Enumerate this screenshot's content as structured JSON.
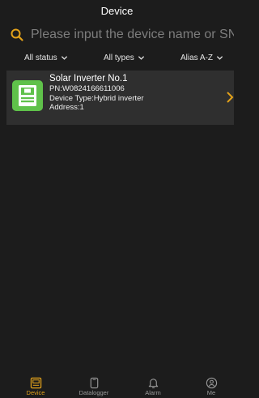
{
  "header": {
    "title": "Device"
  },
  "search": {
    "placeholder": "Please input the device name or SN"
  },
  "filters": [
    {
      "label": "All status"
    },
    {
      "label": "All types"
    },
    {
      "label": "Alias A-Z"
    }
  ],
  "devices": [
    {
      "name": "Solar Inverter No.1",
      "pn": "PN:W0824166611006",
      "type": "Device Type:Hybrid inverter",
      "address": "Address:1",
      "icon": "inverter-icon",
      "icon_color": "#5fc14a"
    }
  ],
  "tabs": [
    {
      "label": "Device",
      "icon": "device-icon",
      "active": true
    },
    {
      "label": "Datalogger",
      "icon": "datalogger-icon",
      "active": false
    },
    {
      "label": "Alarm",
      "icon": "bell-icon",
      "active": false
    },
    {
      "label": "Me",
      "icon": "person-icon",
      "active": false
    }
  ],
  "colors": {
    "accent": "#e3a21a",
    "background": "#1c1c1c",
    "card": "#2f2f2f",
    "inactive": "#9a9a9a"
  }
}
